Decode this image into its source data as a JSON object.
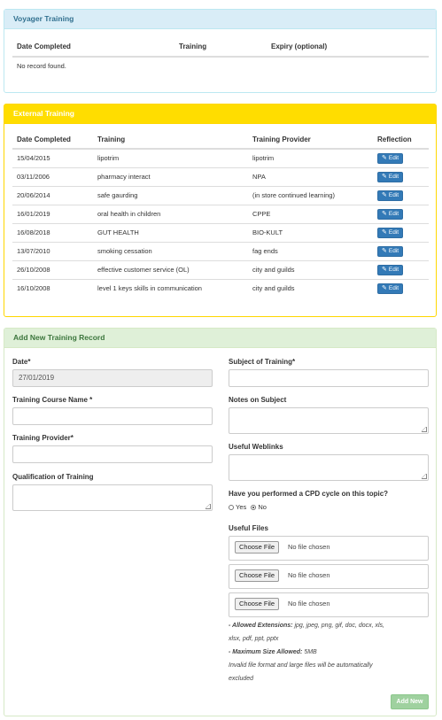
{
  "voyager": {
    "title": "Voyager Training",
    "columns": [
      "Date Completed",
      "Training",
      "Expiry (optional)"
    ],
    "empty_text": "No record found."
  },
  "external": {
    "title": "External Training",
    "columns": [
      "Date Completed",
      "Training",
      "Training Provider",
      "Reflection"
    ],
    "rows": [
      {
        "date": "15/04/2015",
        "training": "lipotrim",
        "provider": "lipotrim",
        "action": "Edit"
      },
      {
        "date": "03/11/2006",
        "training": "pharmacy interact",
        "provider": "NPA",
        "action": "Edit"
      },
      {
        "date": "20/06/2014",
        "training": "safe gaurding",
        "provider": "(in store continued learning)",
        "action": "Edit"
      },
      {
        "date": "16/01/2019",
        "training": "oral health in children",
        "provider": "CPPE",
        "action": "Edit"
      },
      {
        "date": "16/08/2018",
        "training": "GUT HEALTH",
        "provider": "BIO-KULT",
        "action": "Edit"
      },
      {
        "date": "13/07/2010",
        "training": "smoking cessation",
        "provider": "fag ends",
        "action": "Edit"
      },
      {
        "date": "26/10/2008",
        "training": "effective customer service (OL)",
        "provider": "city and guilds",
        "action": "Edit"
      },
      {
        "date": "16/10/2008",
        "training": "level 1 keys skills in communication",
        "provider": "city and guilds",
        "action": "Edit"
      }
    ]
  },
  "form": {
    "title": "Add New Training Record",
    "date_label": "Date*",
    "date_value": "27/01/2019",
    "course_label": "Training Course Name *",
    "provider_label": "Training Provider*",
    "qualification_label": "Qualification of Training",
    "subject_label": "Subject of Training*",
    "notes_label": "Notes on Subject",
    "weblinks_label": "Useful Weblinks",
    "cpd_label": "Have you performed a CPD cycle on this topic?",
    "cpd_yes": "Yes",
    "cpd_no": "No",
    "cpd_selected": "No",
    "files_label": "Useful Files",
    "choose_file": "Choose File",
    "no_file": "No file chosen",
    "ext_label": "- Allowed Extensions:",
    "ext_value": "jpg, jpeg, png, gif, doc, docx, xls,",
    "ext_value2": "xlsx, pdf, ppt, pptx",
    "size_label": "- Maximum Size Allowed:",
    "size_value": "5MB",
    "invalid_line1": "Invalid file format and large files will be automatically",
    "invalid_line2": "excluded",
    "submit_label": "Add New"
  },
  "colors": {
    "info_heading": "#d9edf7",
    "warning_heading": "#ffdd00",
    "success_heading": "#dff0d8",
    "edit_button": "#337ab7",
    "add_button": "#9fd19f"
  }
}
